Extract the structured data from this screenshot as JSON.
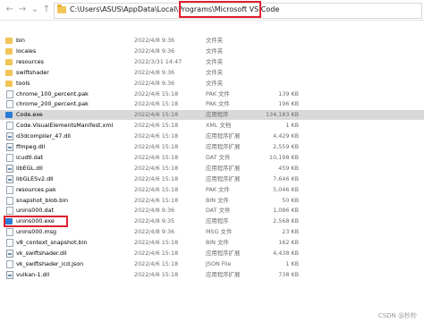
{
  "address_bar": {
    "path_prefix": "C:\\Users\\ASUS\\AppData\\Local\\Programs\\",
    "path_current": "Microsoft VS Code"
  },
  "nav": {
    "back": "←",
    "forward": "→",
    "dropdown": "⌄",
    "up": "↑"
  },
  "files": [
    {
      "name": "bin",
      "date": "2022/4/8 9:36",
      "type": "文件夹",
      "size": "",
      "icon": "folder-icon"
    },
    {
      "name": "locales",
      "date": "2022/4/8 9:36",
      "type": "文件夹",
      "size": "",
      "icon": "folder-icon"
    },
    {
      "name": "resources",
      "date": "2022/3/31 14:47",
      "type": "文件夹",
      "size": "",
      "icon": "folder-icon"
    },
    {
      "name": "swiftshader",
      "date": "2022/4/8 9:36",
      "type": "文件夹",
      "size": "",
      "icon": "folder-icon"
    },
    {
      "name": "tools",
      "date": "2022/4/8 9:36",
      "type": "文件夹",
      "size": "",
      "icon": "folder-icon"
    },
    {
      "name": "chrome_100_percent.pak",
      "date": "2022/4/6 15:18",
      "type": "PAK 文件",
      "size": "139 KB",
      "icon": "file-icon"
    },
    {
      "name": "chrome_200_percent.pak",
      "date": "2022/4/6 15:18",
      "type": "PAK 文件",
      "size": "196 KB",
      "icon": "file-icon"
    },
    {
      "name": "Code.exe",
      "date": "2022/4/6 15:18",
      "type": "应用程序",
      "size": "134,183 KB",
      "icon": "vscode-icon"
    },
    {
      "name": "Code.VisualElementsManifest.xml",
      "date": "2022/4/6 15:18",
      "type": "XML 文档",
      "size": "1 KB",
      "icon": "xml-file-icon"
    },
    {
      "name": "d3dcompiler_47.dll",
      "date": "2022/4/6 15:18",
      "type": "应用程序扩展",
      "size": "4,429 KB",
      "icon": "dll-icon"
    },
    {
      "name": "ffmpeg.dll",
      "date": "2022/4/6 15:18",
      "type": "应用程序扩展",
      "size": "2,559 KB",
      "icon": "dll-icon"
    },
    {
      "name": "icudtl.dat",
      "date": "2022/4/6 15:18",
      "type": "DAT 文件",
      "size": "10,198 KB",
      "icon": "file-icon"
    },
    {
      "name": "libEGL.dll",
      "date": "2022/4/6 15:18",
      "type": "应用程序扩展",
      "size": "459 KB",
      "icon": "dll-icon"
    },
    {
      "name": "libGLESv2.dll",
      "date": "2022/4/6 15:18",
      "type": "应用程序扩展",
      "size": "7,646 KB",
      "icon": "dll-icon"
    },
    {
      "name": "resources.pak",
      "date": "2022/4/6 15:18",
      "type": "PAK 文件",
      "size": "5,046 KB",
      "icon": "file-icon"
    },
    {
      "name": "snapshot_blob.bin",
      "date": "2022/4/6 15:18",
      "type": "BIN 文件",
      "size": "50 KB",
      "icon": "file-icon"
    },
    {
      "name": "unins000.dat",
      "date": "2022/4/8 9:36",
      "type": "DAT 文件",
      "size": "1,086 KB",
      "icon": "file-icon"
    },
    {
      "name": "unins000.exe",
      "date": "2022/4/8 9:35",
      "type": "应用程序",
      "size": "2,568 KB",
      "icon": "vscode-icon"
    },
    {
      "name": "unins000.msg",
      "date": "2022/4/8 9:36",
      "type": "MSG 文件",
      "size": "23 KB",
      "icon": "file-icon"
    },
    {
      "name": "v8_context_snapshot.bin",
      "date": "2022/4/6 15:18",
      "type": "BIN 文件",
      "size": "162 KB",
      "icon": "file-icon"
    },
    {
      "name": "vk_swiftshader.dll",
      "date": "2022/4/6 15:18",
      "type": "应用程序扩展",
      "size": "4,438 KB",
      "icon": "dll-icon"
    },
    {
      "name": "vk_swiftshader_icd.json",
      "date": "2022/4/6 15:18",
      "type": "JSON File",
      "size": "1 KB",
      "icon": "file-icon"
    },
    {
      "name": "vulkan-1.dll",
      "date": "2022/4/6 15:18",
      "type": "应用程序扩展",
      "size": "738 KB",
      "icon": "dll-icon"
    }
  ],
  "selected_index": 7,
  "highlight_colors": {
    "red_box": "#e0202e",
    "selection": "#d9d9d9"
  },
  "watermark": "CSDN @杪杪"
}
